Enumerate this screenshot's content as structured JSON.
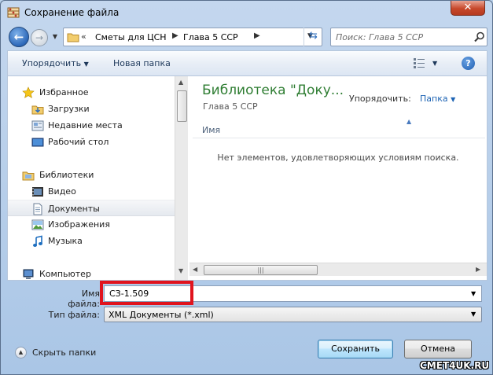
{
  "window": {
    "title": "Сохранение файла",
    "close_glyph": "✕",
    "icons": {
      "app": "abacus-app-icon",
      "close": "close-icon"
    }
  },
  "nav": {
    "breadcrumbs": [
      "Сметы для ЦСН",
      "Глава 5 ССР"
    ],
    "overflow_chevron": "«",
    "search_placeholder": "Поиск: Глава 5 ССР",
    "icons": {
      "back": "back-arrow-icon",
      "forward": "forward-arrow-icon",
      "refresh": "refresh-icon",
      "search": "search-icon"
    }
  },
  "toolbar": {
    "organize": "Упорядочить",
    "new_folder": "Новая папка",
    "help_glyph": "?"
  },
  "sidebar": {
    "groups": [
      {
        "label": "Избранное",
        "icon": "star-icon"
      },
      {
        "label": "Загрузки",
        "icon": "downloads-folder-icon"
      },
      {
        "label": "Недавние места",
        "icon": "recent-places-icon"
      },
      {
        "label": "Рабочий стол",
        "icon": "desktop-icon"
      },
      {
        "label": "Библиотеки",
        "icon": "libraries-icon"
      },
      {
        "label": "Видео",
        "icon": "video-icon"
      },
      {
        "label": "Документы",
        "icon": "documents-icon",
        "selected": true
      },
      {
        "label": "Изображения",
        "icon": "pictures-icon"
      },
      {
        "label": "Музыка",
        "icon": "music-icon"
      },
      {
        "label": "Компьютер",
        "icon": "computer-icon"
      }
    ]
  },
  "content": {
    "library_title": "Библиотека \"Доку...",
    "library_subtitle": "Глава 5 ССР",
    "arrange_label": "Упорядочить:",
    "arrange_value": "Папка",
    "column_name": "Имя",
    "empty_message": "Нет элементов, удовлетворяющих условиям поиска."
  },
  "form": {
    "filename_label": "Имя файла:",
    "filename_value": "СЗ-1.509",
    "filetype_label": "Тип файла:",
    "filetype_value": "XML Документы (*.xml)"
  },
  "footer": {
    "hide_folders": "Скрыть папки",
    "save": "Сохранить",
    "cancel": "Отмена"
  },
  "watermark": "CMET4UK.RU",
  "colors": {
    "accent_green": "#2e7d32",
    "link_blue": "#1e64b4",
    "highlight_red": "#e0141e"
  }
}
